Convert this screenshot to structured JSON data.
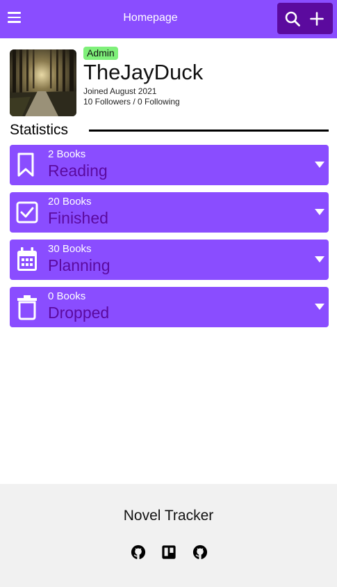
{
  "header": {
    "title": "Homepage",
    "menu_icon": "hamburger-menu-icon",
    "search_icon": "search-icon",
    "add_icon": "plus-icon"
  },
  "profile": {
    "role_badge": "Admin",
    "username": "TheJayDuck",
    "joined": "Joined August 2021",
    "follow_stats": "10 Followers / 0 Following"
  },
  "statistics": {
    "heading": "Statistics",
    "lists": [
      {
        "count": "2 Books",
        "label": "Reading",
        "icon": "bookmark-icon"
      },
      {
        "count": "20 Books",
        "label": "Finished",
        "icon": "checkbox-icon"
      },
      {
        "count": "30 Books",
        "label": "Planning",
        "icon": "calendar-icon"
      },
      {
        "count": "0 Books",
        "label": "Dropped",
        "icon": "trash-icon"
      }
    ]
  },
  "footer": {
    "title": "Novel Tracker",
    "links": [
      "github-icon",
      "trello-icon",
      "github-icon"
    ]
  },
  "colors": {
    "primary": "#8a4dff",
    "primary_dark": "#5b0a9e",
    "badge": "#7ff07a",
    "footer_bg": "#f1f1f1"
  }
}
